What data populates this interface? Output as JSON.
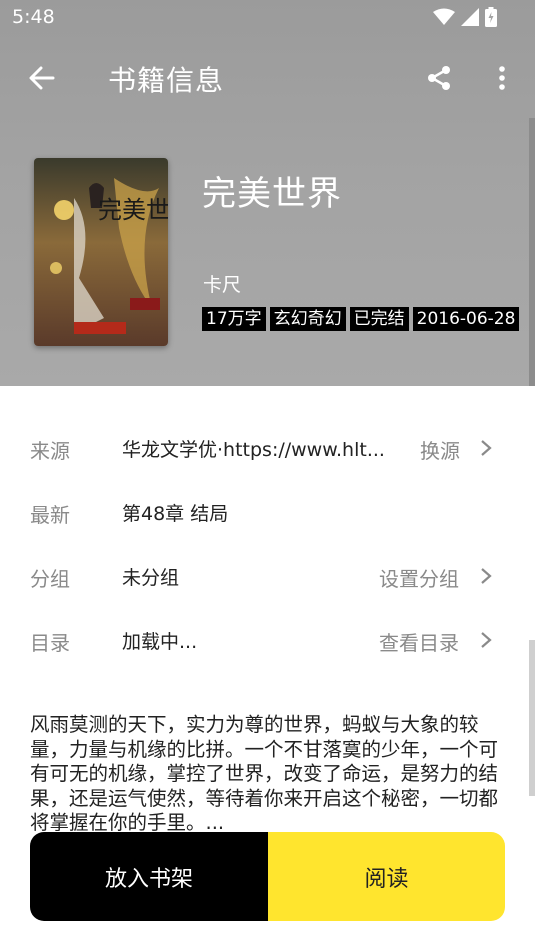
{
  "status_bar": {
    "time": "5:48"
  },
  "toolbar": {
    "title": "书籍信息"
  },
  "book": {
    "title": "完美世界",
    "author": "卡尺",
    "tags": [
      "17万字",
      "玄幻奇幻",
      "已完结",
      "2016-06-28"
    ],
    "cover_text": "完美世界"
  },
  "info": {
    "source": {
      "label": "来源",
      "value": "华龙文学优·https://www.hlt...",
      "action": "换源"
    },
    "latest": {
      "label": "最新",
      "value": "第48章 结局"
    },
    "group": {
      "label": "分组",
      "value": "未分组",
      "action": "设置分组"
    },
    "toc": {
      "label": "目录",
      "value": "加载中...",
      "action": "查看目录"
    }
  },
  "intro": "风雨莫测的天下，实力为尊的世界，蚂蚁与大象的较量，力量与机缘的比拼。一个不甘落寞的少年，一个可有可无的机缘，掌控了世界，改变了命运，是努力的结果，还是运气使然，等待着你来开启这个秘密，一切都将掌握在你的手里。...",
  "buttons": {
    "add_to_shelf": "放入书架",
    "read": "阅读"
  },
  "colors": {
    "accent": "#ffe52e",
    "dark": "#000000",
    "header_bg": "#a3a3a3"
  }
}
